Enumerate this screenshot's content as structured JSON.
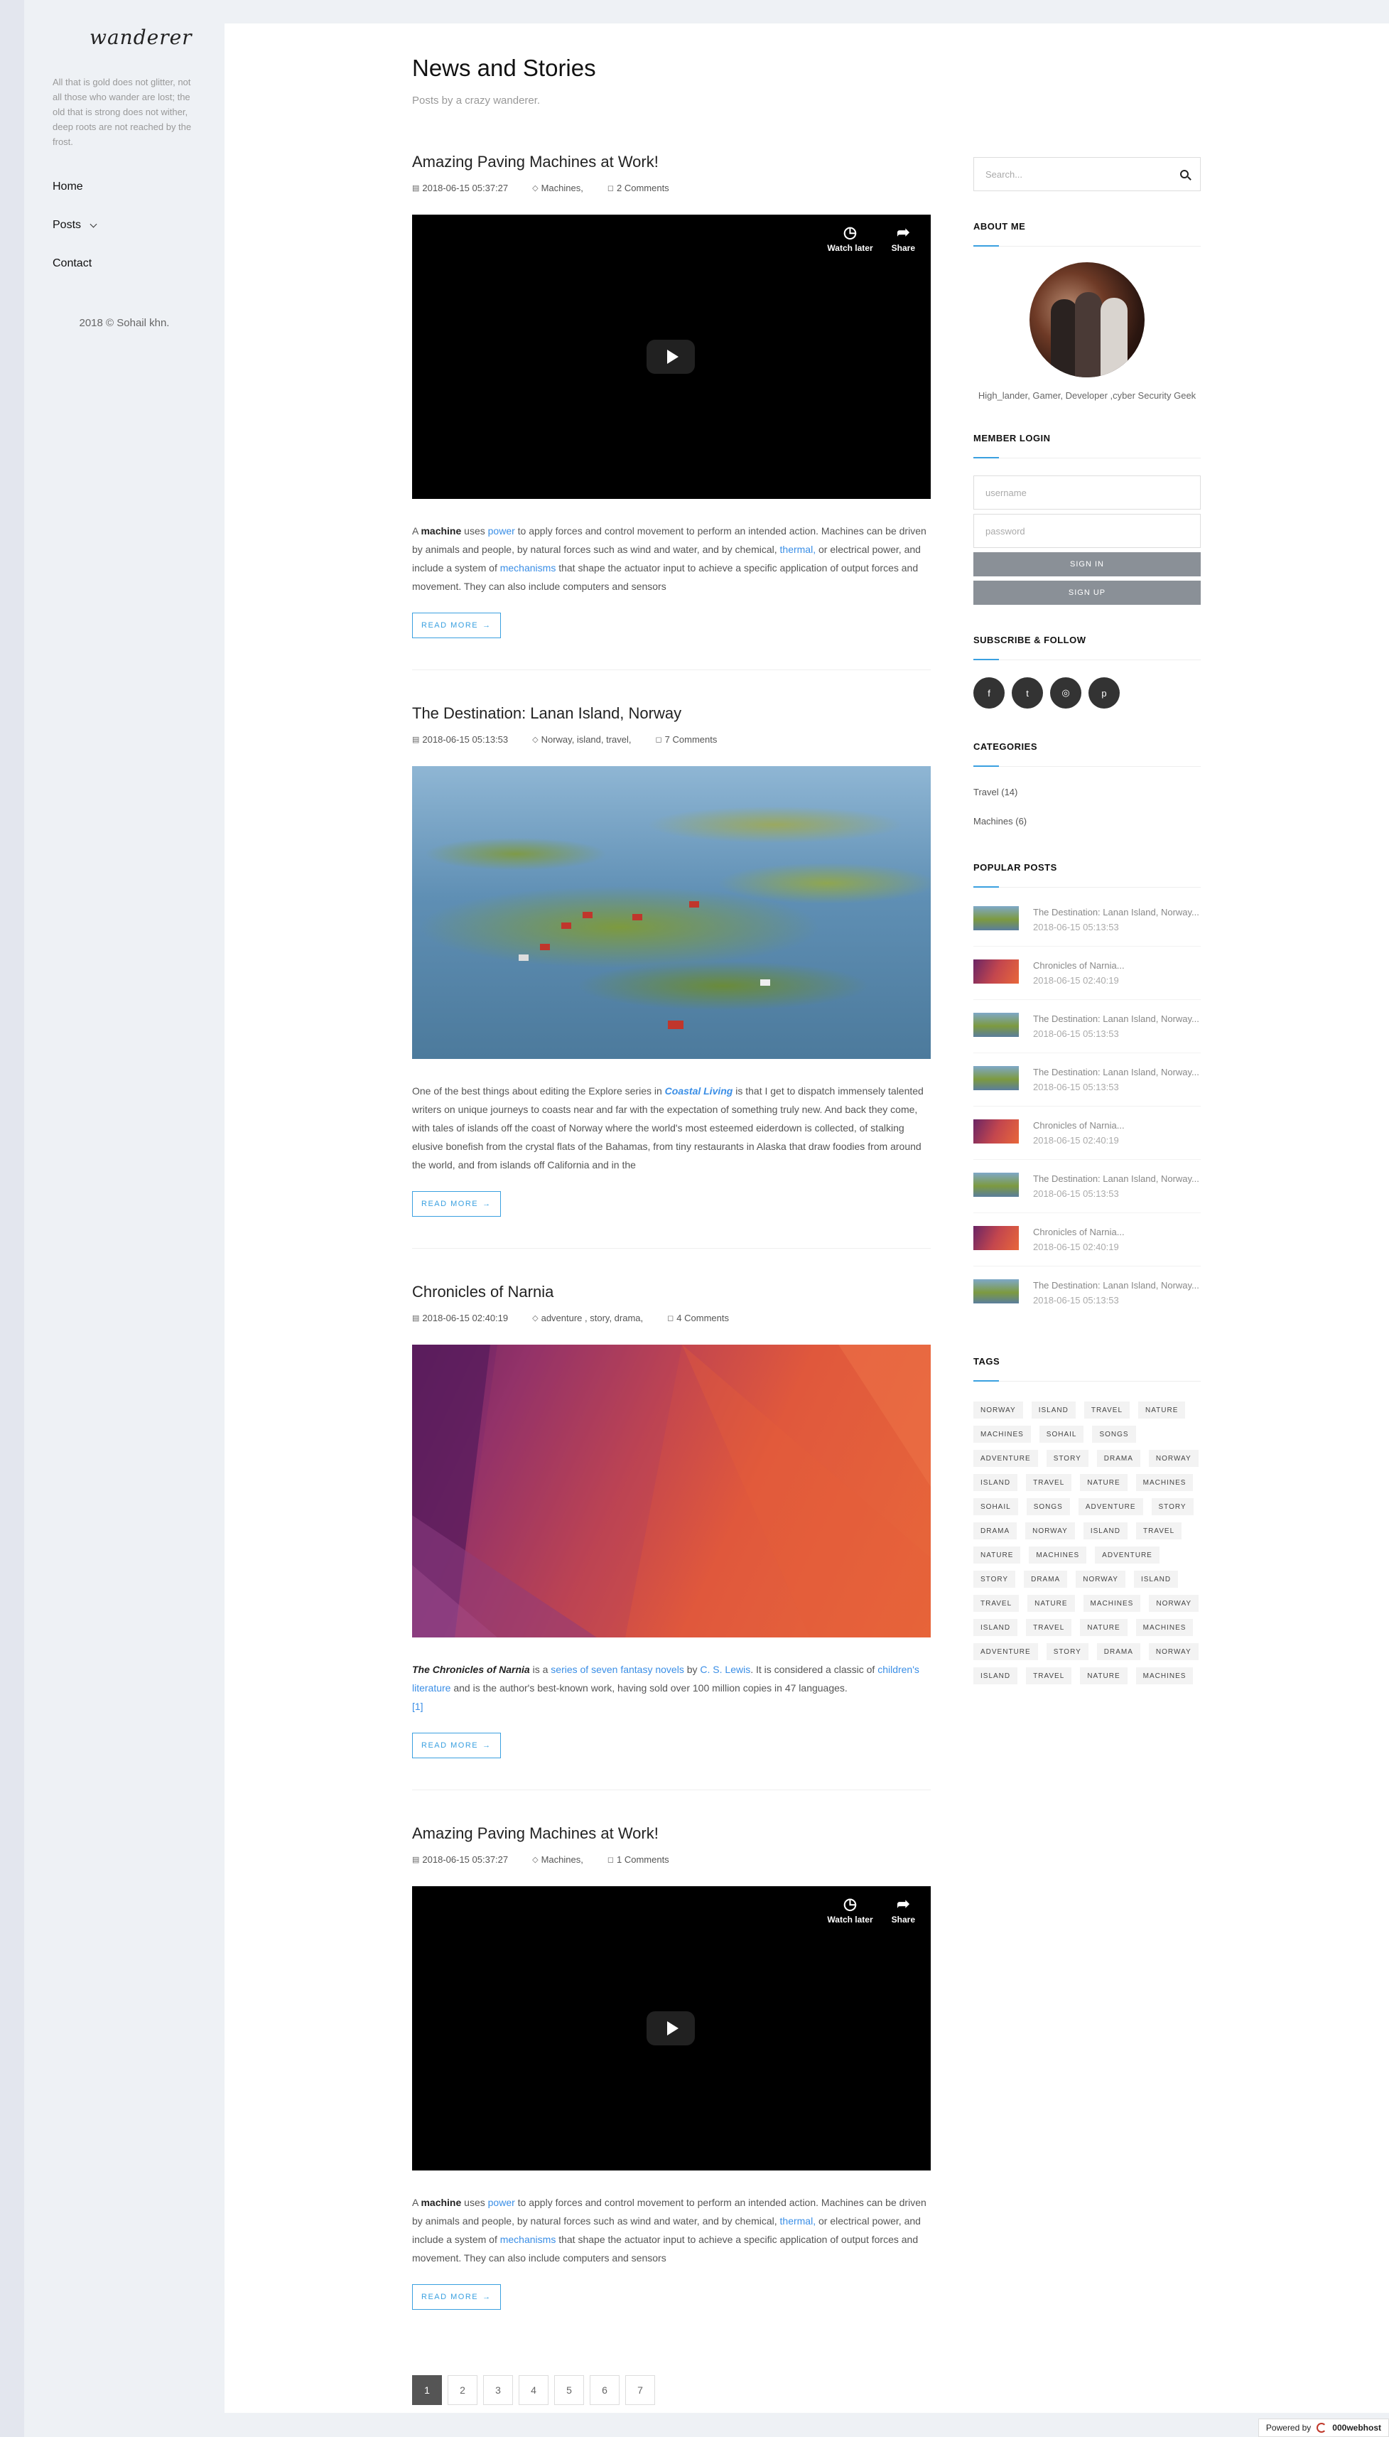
{
  "sidebar": {
    "logo": "wanderer",
    "tagline": "All that is gold does not glitter, not all those who wander are lost; the old that is strong does not wither, deep roots are not reached by the frost.",
    "nav": [
      "Home",
      "Posts",
      "Contact"
    ],
    "copyright": "2018 © Sohail khn."
  },
  "header": {
    "title": "News and Stories",
    "subtitle": "Posts by a crazy wanderer."
  },
  "video_buttons": {
    "watch_later": "Watch later",
    "share": "Share"
  },
  "read_more": "READ MORE",
  "posts": [
    {
      "title": "Amazing Paving Machines at Work!",
      "date": "2018-06-15 05:37:27",
      "tags": "Machines,",
      "comments": "2 Comments",
      "excerpt": {
        "p1": "A ",
        "b1": "machine",
        "p2": " uses ",
        "a1": "power",
        "p3": " to apply forces and control movement to perform an intended action. Machines can be driven by animals and people, by natural forces such as wind and water, and by chemical, ",
        "a2": "thermal,",
        "p4": " or electrical power, and include a system of ",
        "a3": "mechanisms",
        "p5": " that shape the actuator input to achieve a specific application of output forces and movement. They can also include computers and sensors"
      }
    },
    {
      "title": "The Destination: Lanan Island, Norway",
      "date": "2018-06-15 05:13:53",
      "tags": "Norway, island, travel,",
      "comments": "7 Comments",
      "excerpt": {
        "p1": "One of the best things about editing the Explore series in ",
        "a1": "Coastal Living",
        "p2": " is that I get to dispatch immensely talented writers on unique journeys to coasts near and far with the expectation of something truly new. And back they come, with tales of islands off the coast of Norway where the world's most esteemed eiderdown is collected, of stalking elusive bonefish from the crystal flats of the Bahamas, from tiny restaurants in Alaska that draw foodies from around the world, and from islands off California and in the"
      }
    },
    {
      "title": "Chronicles of Narnia",
      "date": "2018-06-15 02:40:19",
      "tags": "adventure , story, drama,",
      "comments": "4 Comments",
      "excerpt": {
        "b1": "The Chronicles of Narnia",
        "p1": " is a ",
        "a1": "series of seven fantasy novels",
        "p2": " by ",
        "a2": "C. S. Lewis",
        "p3": ". It is considered a classic of ",
        "a3": "children's literature",
        "p4": " and is the author's best-known work, having sold over 100 million copies in 47 languages.",
        "a4": "[1]"
      }
    },
    {
      "title": "Amazing Paving Machines at Work!",
      "date": "2018-06-15 05:37:27",
      "tags": "Machines,",
      "comments": "1 Comments",
      "excerpt": {
        "p1": "A ",
        "b1": "machine",
        "p2": " uses ",
        "a1": "power",
        "p3": " to apply forces and control movement to perform an intended action. Machines can be driven by animals and people, by natural forces such as wind and water, and by chemical, ",
        "a2": "thermal,",
        "p4": " or electrical power, and include a system of ",
        "a3": "mechanisms",
        "p5": " that shape the actuator input to achieve a specific application of output forces and movement. They can also include computers and sensors"
      }
    }
  ],
  "pagination": [
    "1",
    "2",
    "3",
    "4",
    "5",
    "6",
    "7"
  ],
  "aside": {
    "search_placeholder": "Search...",
    "about_title": "ABOUT ME",
    "about_text": "High_lander, Gamer, Developer ,cyber Security Geek",
    "login_title": "MEMBER LOGIN",
    "username_placeholder": "username",
    "password_placeholder": "password",
    "sign_in": "SIGN IN",
    "sign_up": "SIGN UP",
    "follow_title": "SUBSCRIBE & FOLLOW",
    "socials": [
      "f",
      "t",
      "◎",
      "p"
    ],
    "categories_title": "CATEGORIES",
    "categories": [
      "Travel  (14)",
      "Machines  (6)"
    ],
    "popular_title": "POPULAR POSTS",
    "popular": [
      {
        "kind": "isl",
        "title": "The Destination: Lanan Island, Norway...",
        "date": "2018-06-15 05:13:53"
      },
      {
        "kind": "nar",
        "title": "Chronicles of Narnia...",
        "date": "2018-06-15 02:40:19"
      },
      {
        "kind": "isl",
        "title": "The Destination: Lanan Island, Norway...",
        "date": "2018-06-15 05:13:53"
      },
      {
        "kind": "isl",
        "title": "The Destination: Lanan Island, Norway...",
        "date": "2018-06-15 05:13:53"
      },
      {
        "kind": "nar",
        "title": "Chronicles of Narnia...",
        "date": "2018-06-15 02:40:19"
      },
      {
        "kind": "isl",
        "title": "The Destination: Lanan Island, Norway...",
        "date": "2018-06-15 05:13:53"
      },
      {
        "kind": "nar",
        "title": "Chronicles of Narnia...",
        "date": "2018-06-15 02:40:19"
      },
      {
        "kind": "isl",
        "title": "The Destination: Lanan Island, Norway...",
        "date": "2018-06-15 05:13:53"
      }
    ],
    "tags_title": "TAGS",
    "tags": [
      "NORWAY",
      "ISLAND",
      "TRAVEL",
      "NATURE",
      "MACHINES",
      "SOHAIL",
      "SONGS",
      "ADVENTURE",
      "STORY",
      "DRAMA",
      "NORWAY",
      "ISLAND",
      "TRAVEL",
      "NATURE",
      "MACHINES",
      "SOHAIL",
      "SONGS",
      "ADVENTURE",
      "STORY",
      "DRAMA",
      "NORWAY",
      "ISLAND",
      "TRAVEL",
      "NATURE",
      "MACHINES",
      "ADVENTURE",
      "STORY",
      "DRAMA",
      "NORWAY",
      "ISLAND",
      "TRAVEL",
      "NATURE",
      "MACHINES",
      "NORWAY",
      "ISLAND",
      "TRAVEL",
      "NATURE",
      "MACHINES",
      "ADVENTURE",
      "STORY",
      "DRAMA",
      "NORWAY",
      "ISLAND",
      "TRAVEL",
      "NATURE",
      "MACHINES"
    ]
  },
  "footer_badge": {
    "label": "Powered by",
    "brand": "000webhost"
  }
}
